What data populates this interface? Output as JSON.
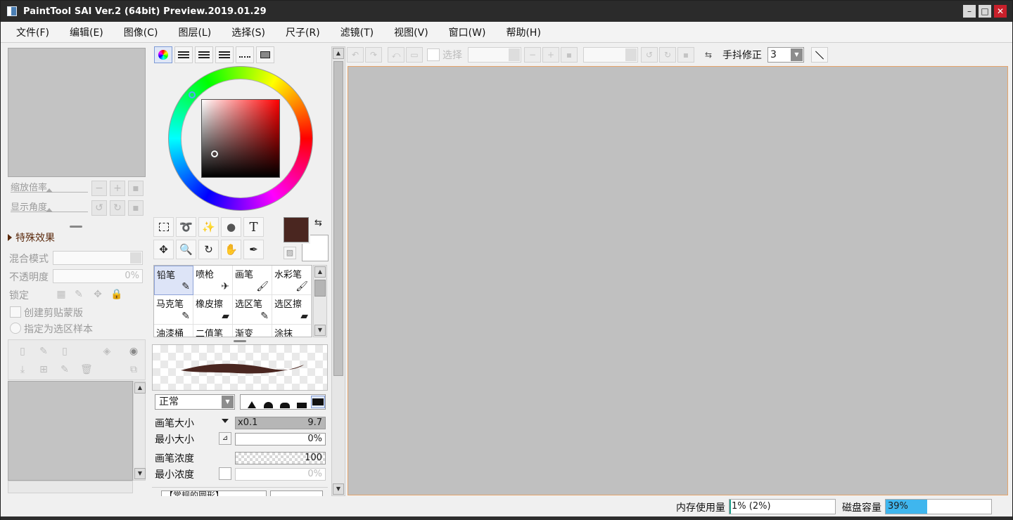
{
  "window": {
    "title": "PaintTool SAI Ver.2 (64bit) Preview.2019.01.29",
    "controls": [
      "–",
      "□",
      "✕"
    ]
  },
  "menu": [
    "文件(F)",
    "编辑(E)",
    "图像(C)",
    "图层(L)",
    "选择(S)",
    "尺子(R)",
    "滤镜(T)",
    "视图(V)",
    "窗口(W)",
    "帮助(H)"
  ],
  "navigator": {
    "zoom_label": "缩放倍率",
    "angle_label": "显示角度"
  },
  "layer_props": {
    "section_title": "特殊效果",
    "blend_label": "混合模式",
    "opacity_label": "不透明度",
    "opacity_value": "0%",
    "lock_label": "锁定",
    "clip_label": "创建剪贴蒙版",
    "sample_label": "指定为选区样本"
  },
  "colors": {
    "foreground": "#4a2620",
    "background": "#ffffff",
    "canvas": "#c0c0c0",
    "canvas_border": "#e5a46b",
    "memory_fill": "#1f9e8a",
    "disk_fill": "#3fb6ee"
  },
  "brushes": [
    {
      "name": "铅笔",
      "icon": "pencil-icon",
      "glyph": "✎",
      "active": true
    },
    {
      "name": "喷枪",
      "icon": "airbrush-icon",
      "glyph": "✈"
    },
    {
      "name": "画笔",
      "icon": "brush-icon",
      "glyph": "🖌"
    },
    {
      "name": "水彩笔",
      "icon": "watercolor-icon",
      "glyph": "🖌"
    },
    {
      "name": "马克笔",
      "icon": "marker-icon",
      "glyph": "✎"
    },
    {
      "name": "橡皮擦",
      "icon": "eraser-icon",
      "glyph": "▰"
    },
    {
      "name": "选区笔",
      "icon": "selection-pen-icon",
      "glyph": "✎"
    },
    {
      "name": "选区擦",
      "icon": "selection-eraser-icon",
      "glyph": "▰"
    },
    {
      "name": "油漆桶",
      "icon": "bucket-icon",
      "glyph": ""
    },
    {
      "name": "二值笔",
      "icon": "binary-pen-icon",
      "glyph": ""
    },
    {
      "name": "渐变",
      "icon": "gradient-icon",
      "glyph": ""
    },
    {
      "name": "涂抹",
      "icon": "smudge-icon",
      "glyph": ""
    }
  ],
  "brush_settings": {
    "mode": "正常",
    "size_label": "画笔大小",
    "size_multiplier": "x0.1",
    "size_value": "9.7",
    "min_size_label": "最小大小",
    "min_size_value": "0%",
    "density_label": "画笔浓度",
    "density_value": "100",
    "min_density_label": "最小浓度",
    "min_density_value": "0%",
    "bottom_combo": "【常规的圆形】"
  },
  "canvas_toolbar": {
    "select_label": "选择",
    "stabilizer_label": "手抖修正",
    "stabilizer_value": "3"
  },
  "status": {
    "memory_label": "内存使用量",
    "memory_value": "1% (2%)",
    "memory_fraction": 0.01,
    "disk_label": "磁盘容量",
    "disk_value": "39%",
    "disk_fraction": 0.39
  }
}
